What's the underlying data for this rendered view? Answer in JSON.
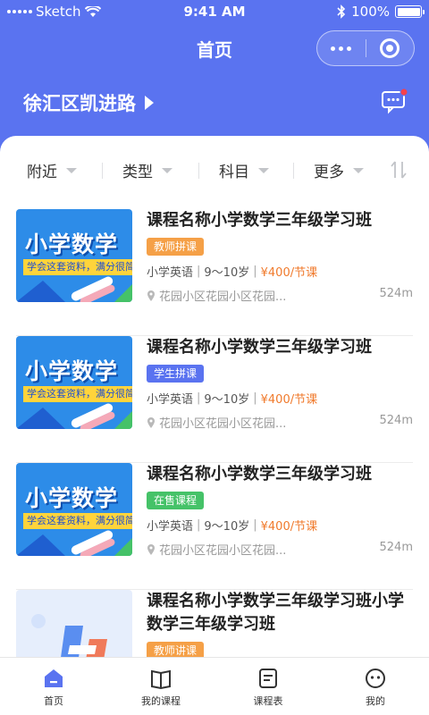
{
  "status_bar": {
    "carrier": "Sketch",
    "time": "9:41 AM",
    "battery": "100%"
  },
  "nav": {
    "title": "首页"
  },
  "location": {
    "name": "徐汇区凯进路"
  },
  "filters": [
    {
      "label": "附近"
    },
    {
      "label": "类型"
    },
    {
      "label": "科目"
    },
    {
      "label": "更多"
    }
  ],
  "courses": [
    {
      "title": "课程名称小学数学三年级学习班",
      "tag": "教师拼课",
      "tag_color": "#f5a047",
      "subject": "小学英语",
      "age": "9～10岁",
      "price": "¥400/节课",
      "address": "花园小区花园小区花园...",
      "distance": "524m",
      "thumb_title": "小学数学",
      "thumb_strip": "学会这套资料，满分很简单"
    },
    {
      "title": "课程名称小学数学三年级学习班",
      "tag": "学生拼课",
      "tag_color": "#5a73f0",
      "subject": "小学英语",
      "age": "9～10岁",
      "price": "¥400/节课",
      "address": "花园小区花园小区花园...",
      "distance": "524m",
      "thumb_title": "小学数学",
      "thumb_strip": "学会这套资料，满分很简单"
    },
    {
      "title": "课程名称小学数学三年级学习班",
      "tag": "在售课程",
      "tag_color": "#45c268",
      "subject": "小学英语",
      "age": "9～10岁",
      "price": "¥400/节课",
      "address": "花园小区花园小区花园...",
      "distance": "524m",
      "thumb_title": "小学数学",
      "thumb_strip": "学会这套资料，满分很简单"
    },
    {
      "title": "课程名称小学数学三年级学习班小学数学三年级学习班",
      "tag": "教师讲课",
      "tag_color": "#f5a047"
    }
  ],
  "tabbar": [
    {
      "label": "首页",
      "icon": "home-icon"
    },
    {
      "label": "我的课程",
      "icon": "book-icon"
    },
    {
      "label": "课程表",
      "icon": "schedule-icon"
    },
    {
      "label": "我的",
      "icon": "profile-icon"
    }
  ]
}
